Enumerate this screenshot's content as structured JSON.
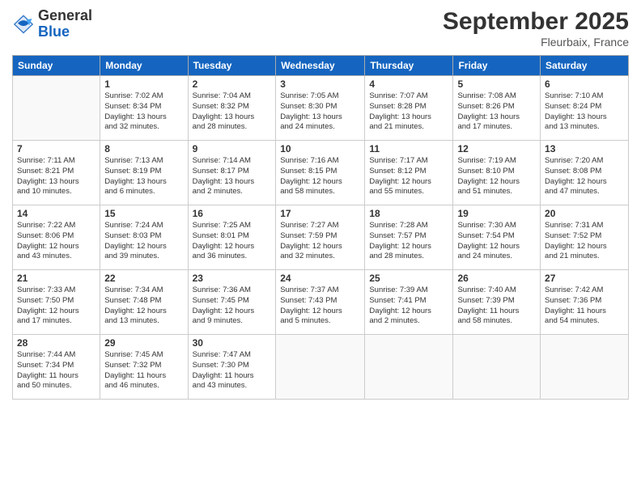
{
  "logo": {
    "general": "General",
    "blue": "Blue"
  },
  "header": {
    "month": "September 2025",
    "location": "Fleurbaix, France"
  },
  "days": [
    "Sunday",
    "Monday",
    "Tuesday",
    "Wednesday",
    "Thursday",
    "Friday",
    "Saturday"
  ],
  "weeks": [
    [
      {
        "day": "",
        "info": ""
      },
      {
        "day": "1",
        "info": "Sunrise: 7:02 AM\nSunset: 8:34 PM\nDaylight: 13 hours\nand 32 minutes."
      },
      {
        "day": "2",
        "info": "Sunrise: 7:04 AM\nSunset: 8:32 PM\nDaylight: 13 hours\nand 28 minutes."
      },
      {
        "day": "3",
        "info": "Sunrise: 7:05 AM\nSunset: 8:30 PM\nDaylight: 13 hours\nand 24 minutes."
      },
      {
        "day": "4",
        "info": "Sunrise: 7:07 AM\nSunset: 8:28 PM\nDaylight: 13 hours\nand 21 minutes."
      },
      {
        "day": "5",
        "info": "Sunrise: 7:08 AM\nSunset: 8:26 PM\nDaylight: 13 hours\nand 17 minutes."
      },
      {
        "day": "6",
        "info": "Sunrise: 7:10 AM\nSunset: 8:24 PM\nDaylight: 13 hours\nand 13 minutes."
      }
    ],
    [
      {
        "day": "7",
        "info": "Sunrise: 7:11 AM\nSunset: 8:21 PM\nDaylight: 13 hours\nand 10 minutes."
      },
      {
        "day": "8",
        "info": "Sunrise: 7:13 AM\nSunset: 8:19 PM\nDaylight: 13 hours\nand 6 minutes."
      },
      {
        "day": "9",
        "info": "Sunrise: 7:14 AM\nSunset: 8:17 PM\nDaylight: 13 hours\nand 2 minutes."
      },
      {
        "day": "10",
        "info": "Sunrise: 7:16 AM\nSunset: 8:15 PM\nDaylight: 12 hours\nand 58 minutes."
      },
      {
        "day": "11",
        "info": "Sunrise: 7:17 AM\nSunset: 8:12 PM\nDaylight: 12 hours\nand 55 minutes."
      },
      {
        "day": "12",
        "info": "Sunrise: 7:19 AM\nSunset: 8:10 PM\nDaylight: 12 hours\nand 51 minutes."
      },
      {
        "day": "13",
        "info": "Sunrise: 7:20 AM\nSunset: 8:08 PM\nDaylight: 12 hours\nand 47 minutes."
      }
    ],
    [
      {
        "day": "14",
        "info": "Sunrise: 7:22 AM\nSunset: 8:06 PM\nDaylight: 12 hours\nand 43 minutes."
      },
      {
        "day": "15",
        "info": "Sunrise: 7:24 AM\nSunset: 8:03 PM\nDaylight: 12 hours\nand 39 minutes."
      },
      {
        "day": "16",
        "info": "Sunrise: 7:25 AM\nSunset: 8:01 PM\nDaylight: 12 hours\nand 36 minutes."
      },
      {
        "day": "17",
        "info": "Sunrise: 7:27 AM\nSunset: 7:59 PM\nDaylight: 12 hours\nand 32 minutes."
      },
      {
        "day": "18",
        "info": "Sunrise: 7:28 AM\nSunset: 7:57 PM\nDaylight: 12 hours\nand 28 minutes."
      },
      {
        "day": "19",
        "info": "Sunrise: 7:30 AM\nSunset: 7:54 PM\nDaylight: 12 hours\nand 24 minutes."
      },
      {
        "day": "20",
        "info": "Sunrise: 7:31 AM\nSunset: 7:52 PM\nDaylight: 12 hours\nand 21 minutes."
      }
    ],
    [
      {
        "day": "21",
        "info": "Sunrise: 7:33 AM\nSunset: 7:50 PM\nDaylight: 12 hours\nand 17 minutes."
      },
      {
        "day": "22",
        "info": "Sunrise: 7:34 AM\nSunset: 7:48 PM\nDaylight: 12 hours\nand 13 minutes."
      },
      {
        "day": "23",
        "info": "Sunrise: 7:36 AM\nSunset: 7:45 PM\nDaylight: 12 hours\nand 9 minutes."
      },
      {
        "day": "24",
        "info": "Sunrise: 7:37 AM\nSunset: 7:43 PM\nDaylight: 12 hours\nand 5 minutes."
      },
      {
        "day": "25",
        "info": "Sunrise: 7:39 AM\nSunset: 7:41 PM\nDaylight: 12 hours\nand 2 minutes."
      },
      {
        "day": "26",
        "info": "Sunrise: 7:40 AM\nSunset: 7:39 PM\nDaylight: 11 hours\nand 58 minutes."
      },
      {
        "day": "27",
        "info": "Sunrise: 7:42 AM\nSunset: 7:36 PM\nDaylight: 11 hours\nand 54 minutes."
      }
    ],
    [
      {
        "day": "28",
        "info": "Sunrise: 7:44 AM\nSunset: 7:34 PM\nDaylight: 11 hours\nand 50 minutes."
      },
      {
        "day": "29",
        "info": "Sunrise: 7:45 AM\nSunset: 7:32 PM\nDaylight: 11 hours\nand 46 minutes."
      },
      {
        "day": "30",
        "info": "Sunrise: 7:47 AM\nSunset: 7:30 PM\nDaylight: 11 hours\nand 43 minutes."
      },
      {
        "day": "",
        "info": ""
      },
      {
        "day": "",
        "info": ""
      },
      {
        "day": "",
        "info": ""
      },
      {
        "day": "",
        "info": ""
      }
    ]
  ]
}
